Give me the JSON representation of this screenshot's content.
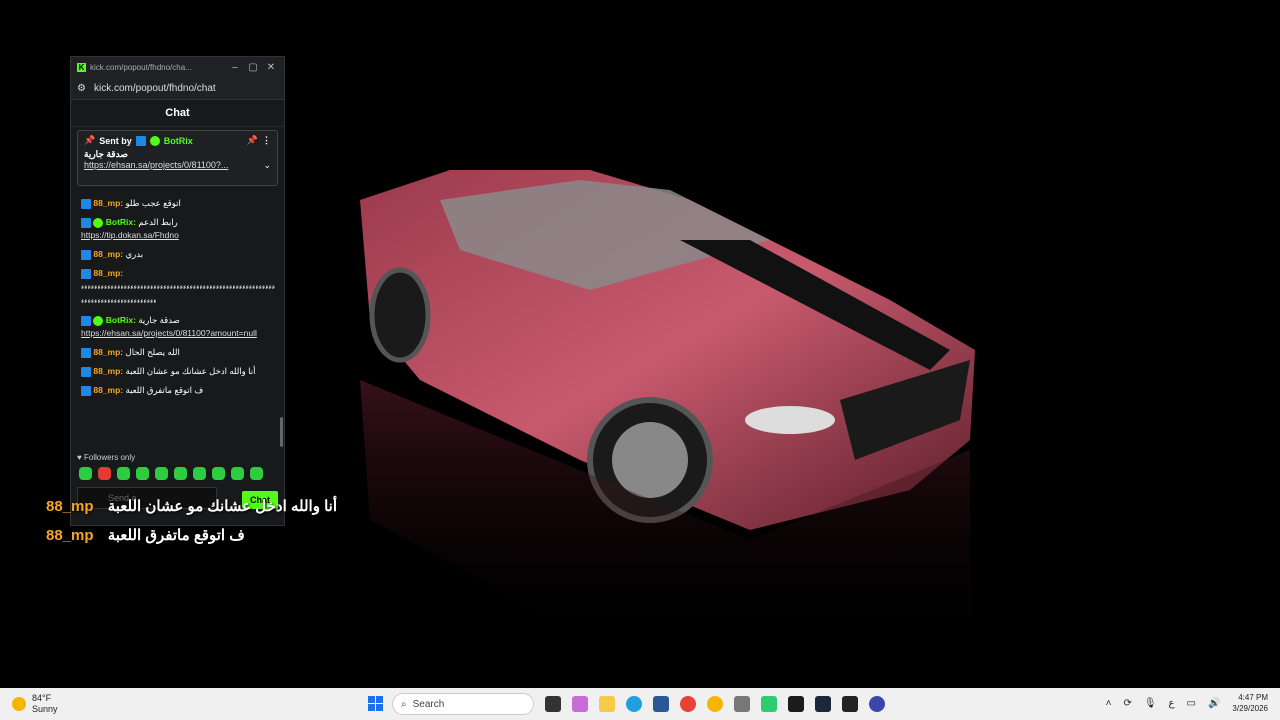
{
  "browser": {
    "title": "kick.com/popout/fhdno/cha...",
    "address": "kick.com/popout/fhdno/chat",
    "minimize": "–",
    "maximize": "▢",
    "close": "✕"
  },
  "chat": {
    "header": "Chat",
    "pinned": {
      "sent_by": "Sent by",
      "user": "BotRix",
      "text": "صدقة جارية",
      "link": "https://ehsan.sa/projects/0/81100?..."
    },
    "messages": [
      {
        "user": "88_mp:",
        "text": "اتوقع عجب طلو"
      },
      {
        "user": "BotRix:",
        "bot": true,
        "text": "رابط الدعم",
        "link": "https://tip.dokan.sa/Fhdno"
      },
      {
        "user": "88_mp:",
        "text": "بدري"
      },
      {
        "user": "88_mp:",
        "text": "ءءءءءءءءءءءءءءءءءءءءءءءءءءءءءءءءءءءءءءءءءءءءءءءءءءءءءءءءءءءءءءءءءءءءءءءءءءءءءءءءءء"
      },
      {
        "user": "BotRix:",
        "bot": true,
        "text": "صدقة جارية",
        "link": "https://ehsan.sa/projects/0/81100?amount=null"
      },
      {
        "user": "88_mp:",
        "text": "الله يصلح الحال"
      },
      {
        "user": "88_mp:",
        "text": "أنا والله ادخل عشانك مو عشان اللعبة"
      },
      {
        "user": "88_mp:",
        "text": "ف اتوقع ماتفرق اللعبة"
      }
    ],
    "followers_only": "Followers only",
    "input_placeholder": "Send a",
    "chat_button": "Chat"
  },
  "overlay": [
    {
      "user": "88_mp",
      "text": "أنا والله ادخل عشانك مو عشان اللعبة"
    },
    {
      "user": "88_mp",
      "text": "ف اتوقع ماتفرق اللعبة"
    }
  ],
  "taskbar": {
    "temp": "84°F",
    "condition": "Sunny",
    "search": "Search",
    "time": "4:47 PM",
    "date": "3/29/2026",
    "lang": "ع"
  }
}
